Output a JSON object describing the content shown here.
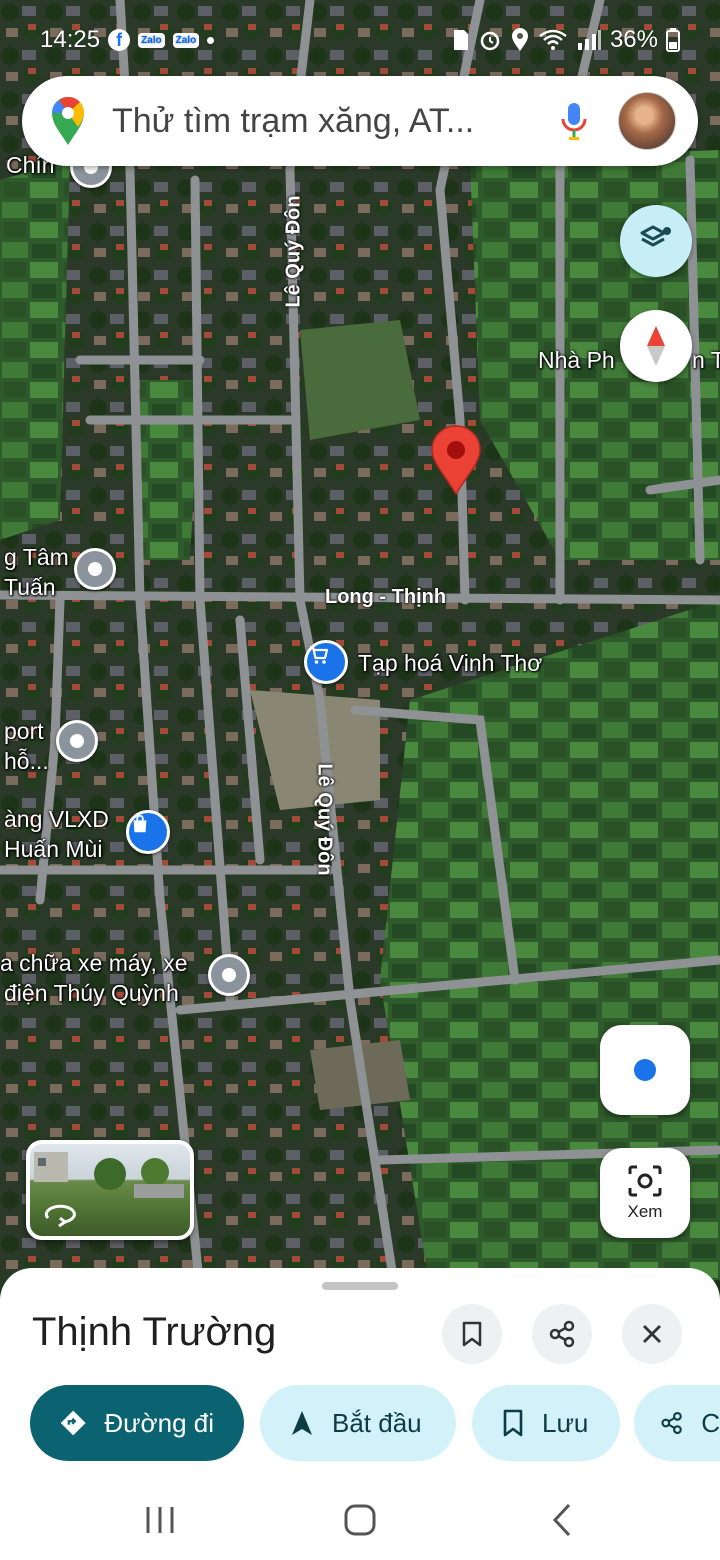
{
  "status_bar": {
    "time": "14:25",
    "battery": "36%",
    "notification_chips": [
      "Zalo",
      "Zalo"
    ]
  },
  "search": {
    "placeholder": "Thử tìm trạm xăng, AT..."
  },
  "map": {
    "roads": {
      "le_quy_don_upper": "Lê Quý Đôn",
      "le_quy_don_lower": "Lê Quý Đôn",
      "long_thinh": "Long - Thịnh"
    },
    "places": {
      "chin": "Chín",
      "nha_pho": "Nhà Ph",
      "nha_pho_tail": "n Tì",
      "tam_tuan_line1": "g Tâm",
      "tam_tuan_line2": "Tuấn",
      "tap_hoa": "Tạp hoá Vinh Thơ",
      "sport_line1": "port",
      "sport_line2": "hỗ...",
      "vlxd_line1": "àng VLXD",
      "vlxd_line2": "Huấn Mùi",
      "sua_xe_line1": "a chữa xe máy, xe",
      "sua_xe_line2": "điện Thúy Quỳnh"
    }
  },
  "view_button": {
    "label": "Xem"
  },
  "sheet": {
    "title": "Thịnh Trường",
    "chips": {
      "directions": "Đường đi",
      "start": "Bắt đầu",
      "save": "Lưu",
      "share": "C"
    }
  },
  "colors": {
    "pin_red": "#ea4335",
    "chip_primary": "#0b6372",
    "chip_secondary": "#d3f1f8",
    "layers_bg": "#c7eef7"
  }
}
